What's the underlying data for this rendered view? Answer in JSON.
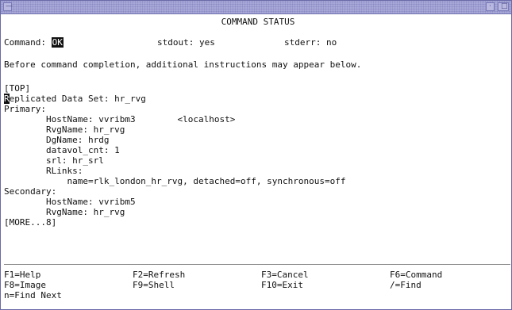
{
  "window": {
    "title_glyphs": {
      "menu": "—",
      "minimize": "·",
      "maximize": "□"
    }
  },
  "screen": {
    "title": "COMMAND STATUS",
    "status": {
      "command_label": "Command:",
      "command_value": "OK",
      "stdout": "stdout: yes",
      "stderr": "stderr: no"
    },
    "notice": "Before command completion, additional instructions may appear below.",
    "output": {
      "top_marker": "[TOP]",
      "rds_first_char": "R",
      "rds_rest": "eplicated Data Set: hr_rvg",
      "primary_label": "Primary:",
      "primary_hostname": "        HostName: vvribm3        <localhost>",
      "primary_rvgname": "        RvgName: hr_rvg",
      "primary_dgname": "        DgName: hrdg",
      "primary_datavol": "        datavol_cnt: 1",
      "primary_srl": "        srl: hr_srl",
      "primary_rlinks": "        RLinks:",
      "primary_rlink_detail": "            name=rlk_london_hr_rvg, detached=off, synchronous=off",
      "secondary_label": "Secondary:",
      "secondary_hostname": "        HostName: vvribm5",
      "secondary_rvgname": "        RvgName: hr_rvg",
      "more_marker": "[MORE...8]"
    },
    "function_keys": {
      "f1": "F1=Help",
      "f2": "F2=Refresh",
      "f3": "F3=Cancel",
      "f6": "F6=Command",
      "f8": "F8=Image",
      "f9": "F9=Shell",
      "f10": "F10=Exit",
      "find": "/=Find",
      "find_next": "n=Find Next"
    }
  }
}
